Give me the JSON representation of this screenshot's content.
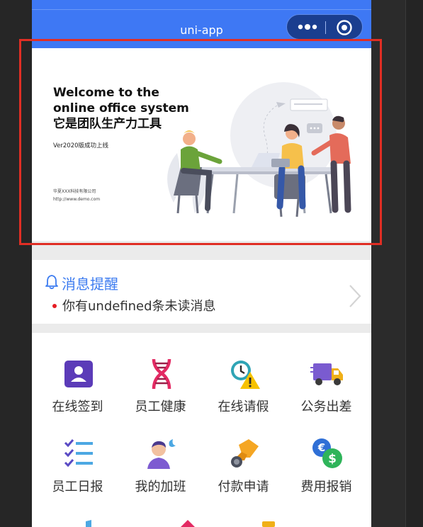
{
  "navbar": {
    "title": "uni-app"
  },
  "banner": {
    "title_line1": "Welcome to the",
    "title_line2": "online office system",
    "title_line3": "它是团队生产力工具",
    "version": "Ver2020版成功上线",
    "company": "华夏XXX科技有限公司",
    "url": "http://www.demo.com"
  },
  "notice": {
    "title": "消息提醒",
    "message": "你有undefined条未读消息"
  },
  "grid": {
    "items": [
      {
        "label": "在线签到",
        "icon": "sign-in-icon"
      },
      {
        "label": "员工健康",
        "icon": "dna-icon"
      },
      {
        "label": "在线请假",
        "icon": "clock-warning-icon"
      },
      {
        "label": "公务出差",
        "icon": "truck-icon"
      },
      {
        "label": "员工日报",
        "icon": "checklist-icon"
      },
      {
        "label": "我的加班",
        "icon": "person-moon-icon"
      },
      {
        "label": "付款申请",
        "icon": "hand-coin-icon"
      },
      {
        "label": "费用报销",
        "icon": "currency-icon"
      }
    ]
  },
  "colors": {
    "navbar": "#3e78f4",
    "accent": "#3d7cf0",
    "unread_dot": "#e51c23",
    "highlight": "#e02e24"
  }
}
